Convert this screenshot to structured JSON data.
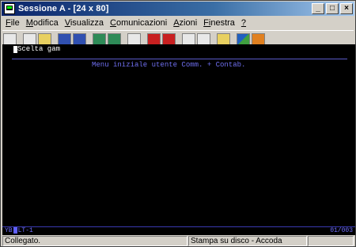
{
  "window": {
    "title": "Sessione A - [24 x 80]",
    "buttons": [
      "_",
      "□",
      "×"
    ]
  },
  "menu": [
    {
      "label": "File",
      "ul": "F",
      "rest": "ile"
    },
    {
      "label": "Modifica",
      "ul": "M",
      "rest": "odifica"
    },
    {
      "label": "Visualizza",
      "ul": "V",
      "rest": "isualizza"
    },
    {
      "label": "Comunicazioni",
      "ul": "C",
      "rest": "omunicazioni"
    },
    {
      "label": "Azioni",
      "ul": "A",
      "rest": "zioni"
    },
    {
      "label": "Finestra",
      "ul": "Fi",
      "rest": "nestra"
    },
    {
      "label": "?",
      "ul": "?",
      "rest": ""
    }
  ],
  "toolbar": {
    "icons": [
      "print-screen-icon",
      "copy-icon",
      "paste-icon",
      "send-file-icon",
      "receive-file-icon",
      "display-icon",
      "keyboard-icon",
      "macro-icon",
      "record-macro-icon",
      "stop-macro-icon",
      "play-macro-icon",
      "play-icon",
      "clipboard-icon",
      "globe-icon",
      "help-icon"
    ]
  },
  "terminal": {
    "line1": "Scelta gam",
    "heading": "Menu iniziale utente Comm. + Contab."
  },
  "oia": {
    "left": "YB",
    "lt": "LT-1",
    "right": "01/003"
  },
  "status": {
    "left": "Collegato.",
    "middle": "Stampa su disco - Accoda",
    "right": ""
  }
}
